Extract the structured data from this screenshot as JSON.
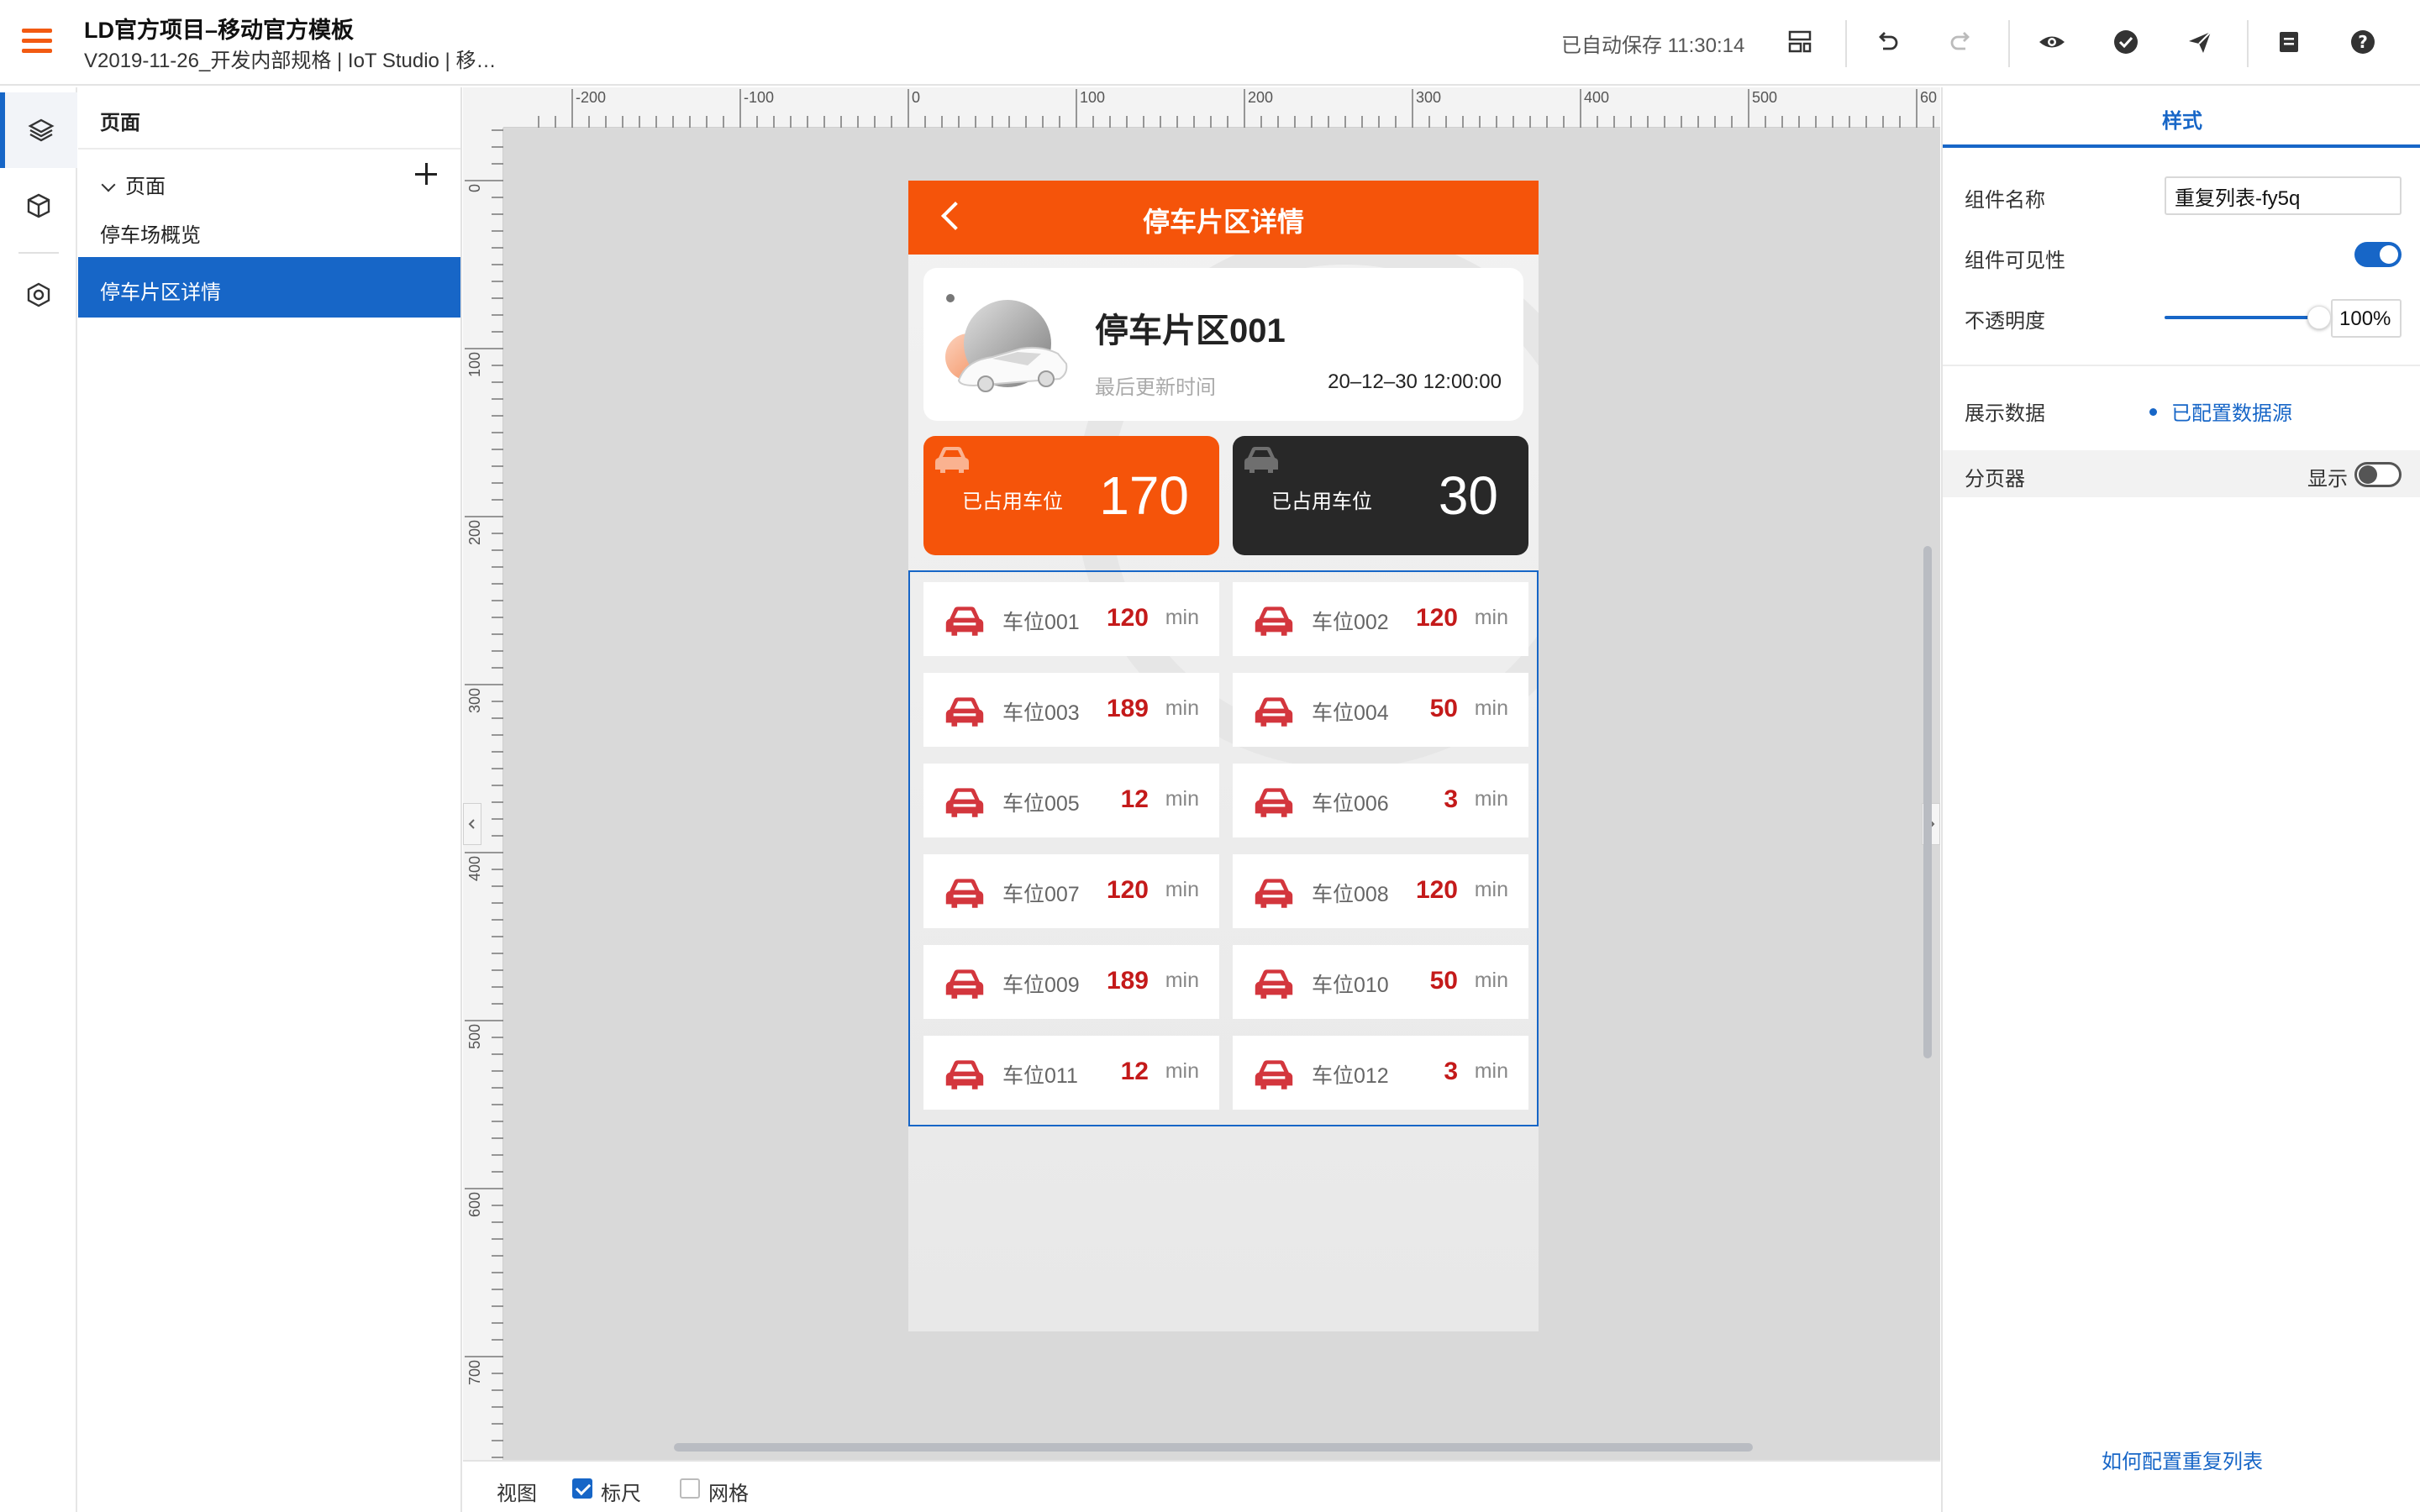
{
  "header": {
    "title": "LD官方项目–移动官方模板",
    "subtitle": "V2019-11-26_开发内部规格 | IoT Studio | 移…",
    "autosave": "已自动保存 11:30:14"
  },
  "tree": {
    "header": "页面",
    "group_label": "页面",
    "items": [
      {
        "label": "停车场概览",
        "active": false
      },
      {
        "label": "停车片区详情",
        "active": true
      }
    ]
  },
  "ruler": {
    "h_labels": [
      "-200",
      "-100",
      "0",
      "100",
      "200",
      "300",
      "400",
      "500",
      "60"
    ],
    "v_labels": [
      "0",
      "100",
      "200",
      "300",
      "400",
      "500",
      "600",
      "700"
    ]
  },
  "phone": {
    "title": "停车片区详情",
    "zone": {
      "name": "停车片区001",
      "update_label": "最后更新时间",
      "update_time": "20–12–30 12:00:00"
    },
    "stats": [
      {
        "label": "已占用车位",
        "value": "170",
        "color": "#f5540a"
      },
      {
        "label": "已占用车位",
        "value": "30",
        "color": "#282828"
      }
    ],
    "slots": [
      {
        "name": "车位001",
        "time": "120",
        "unit": "min"
      },
      {
        "name": "车位002",
        "time": "120",
        "unit": "min"
      },
      {
        "name": "车位003",
        "time": "189",
        "unit": "min"
      },
      {
        "name": "车位004",
        "time": "50",
        "unit": "min"
      },
      {
        "name": "车位005",
        "time": "12",
        "unit": "min"
      },
      {
        "name": "车位006",
        "time": "3",
        "unit": "min"
      },
      {
        "name": "车位007",
        "time": "120",
        "unit": "min"
      },
      {
        "name": "车位008",
        "time": "120",
        "unit": "min"
      },
      {
        "name": "车位009",
        "time": "189",
        "unit": "min"
      },
      {
        "name": "车位010",
        "time": "50",
        "unit": "min"
      },
      {
        "name": "车位011",
        "time": "12",
        "unit": "min"
      },
      {
        "name": "车位012",
        "time": "3",
        "unit": "min"
      }
    ]
  },
  "viewbar": {
    "label": "视图",
    "ruler_label": "标尺",
    "ruler_checked": true,
    "grid_label": "网格",
    "grid_checked": false
  },
  "props": {
    "tab": "样式",
    "name_label": "组件名称",
    "name_value": "重复列表-fy5q",
    "visible_label": "组件可见性",
    "visible_on": true,
    "opacity_label": "不透明度",
    "opacity_value": "100%",
    "data_label": "展示数据",
    "data_link": "已配置数据源",
    "pager_label": "分页器",
    "pager_show": "显示",
    "pager_on": false,
    "help_link": "如何配置重复列表"
  },
  "colors": {
    "accent": "#1766c7",
    "brand_orange": "#f5540a",
    "slot_icon": "#d3363d",
    "slot_time": "#c41a1a"
  }
}
